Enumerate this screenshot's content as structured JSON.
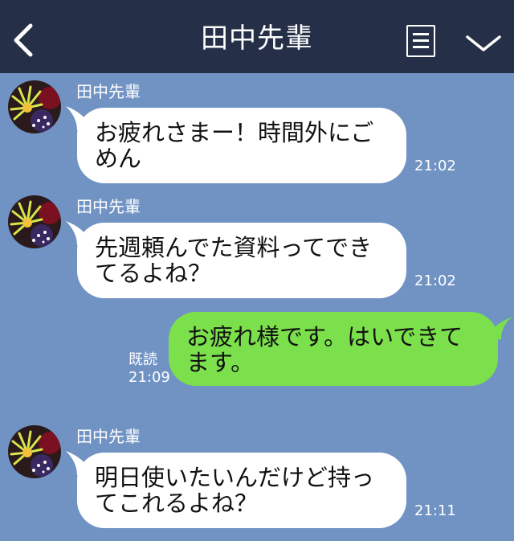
{
  "header": {
    "title": "田中先輩",
    "back_icon": "chevron-left-icon",
    "menu_icon": "menu-icon",
    "expand_icon": "chevron-down-icon",
    "background": "#253048"
  },
  "colors": {
    "chat_background": "#7093c4",
    "incoming_bubble": "#ffffff",
    "outgoing_bubble": "#7be04b"
  },
  "messages": [
    {
      "direction": "incoming",
      "sender": "田中先輩",
      "text_line1": "お疲れさまー！時間外にご",
      "text_line2": "めん",
      "time": "21:02"
    },
    {
      "direction": "incoming",
      "sender": "田中先輩",
      "text_line1": "先週頼んでた資料ってでき",
      "text_line2": "てるよね？",
      "time": "21:02"
    },
    {
      "direction": "outgoing",
      "text_line1": "お疲れ様です。はいできて",
      "text_line2": "ます。",
      "read_label": "既読",
      "time": "21:09"
    },
    {
      "direction": "incoming",
      "sender": "田中先輩",
      "text_line1": "明日使いたいんだけど持っ",
      "text_line2": "てこれるよね？",
      "time": "21:11"
    }
  ]
}
